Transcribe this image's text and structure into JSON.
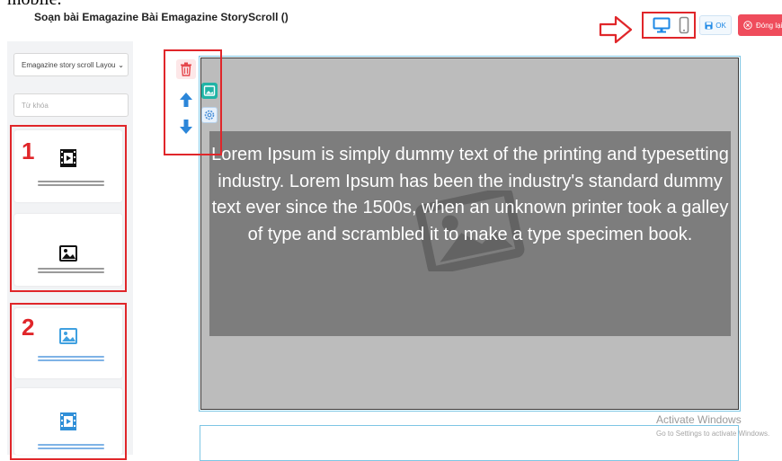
{
  "page": {
    "clipped_top_text": "mobile.",
    "title": "Soạn bài Emagazine Bài Emagazine StoryScroll ()"
  },
  "toolbar": {
    "ok_label": "OK",
    "close_label": "Đóng lại"
  },
  "sidebar": {
    "layout_select_value": "Emagazine story scroll Layou",
    "search_placeholder": "Từ khóa",
    "group_1_label": "1",
    "group_2_label": "2"
  },
  "block": {
    "text": "Lorem Ipsum is simply dummy text of the printing and typesetting industry. Lorem Ipsum has been the industry's standard dummy text ever since the 1500s, when an unknown printer took a galley of type and scrambled it to make a type specimen book."
  },
  "watermark": {
    "title": "Activate Windows",
    "subtitle": "Go to Settings to activate Windows."
  },
  "colors": {
    "annotation_red": "#e0262a",
    "primary_blue": "#1e88e5",
    "danger": "#ef4c5c",
    "teal": "#21b4a6"
  },
  "icons": {
    "arrow": "arrow-right-outline-icon",
    "desktop": "desktop-icon",
    "mobile": "mobile-icon",
    "save": "save-icon",
    "close": "close-circle-icon",
    "trash": "trash-icon",
    "up": "arrow-up-icon",
    "down": "arrow-down-icon",
    "image": "image-icon",
    "gear": "gear-icon",
    "film": "film-icon"
  }
}
